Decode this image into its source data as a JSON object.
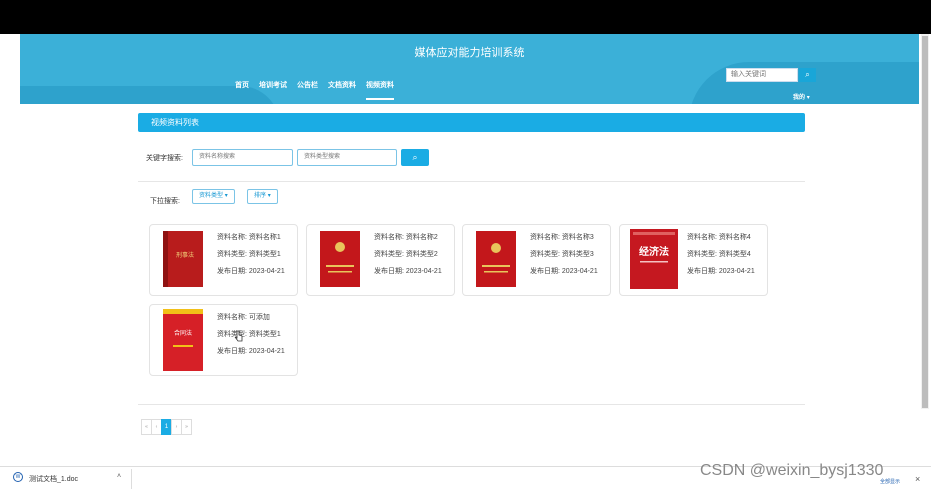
{
  "header": {
    "title": "媒体应对能力培训系统",
    "nav": [
      "首页",
      "培训考试",
      "公告栏",
      "文档资料",
      "视频资料"
    ],
    "active_nav": 4,
    "search_placeholder": "输入关键词",
    "user_menu": "我的"
  },
  "panel": {
    "title": "视频资料列表"
  },
  "search": {
    "label": "关键字搜索:",
    "name_placeholder": "资料名称搜索",
    "type_placeholder": "资料类型搜索"
  },
  "dropdown": {
    "label": "下拉搜索:",
    "type_button": "资料类型",
    "sort_button": "排序"
  },
  "fields": {
    "name": "资料名称:",
    "type": "资料类型:",
    "date": "发布日期:"
  },
  "items": [
    {
      "name": "资料名称1",
      "type": "资料类型1",
      "date": "2023-04-21",
      "cover_color": "#b81c1c",
      "cover_text": "刑事法"
    },
    {
      "name": "资料名称2",
      "type": "资料类型2",
      "date": "2023-04-21",
      "cover_color": "#c3171b",
      "cover_text": ""
    },
    {
      "name": "资料名称3",
      "type": "资料类型3",
      "date": "2023-04-21",
      "cover_color": "#c3171b",
      "cover_text": ""
    },
    {
      "name": "资料名称4",
      "type": "资料类型4",
      "date": "2023-04-21",
      "cover_color": "#c51820",
      "cover_text": "经济法"
    },
    {
      "name": "可添加",
      "type": "资料类型1",
      "date": "2023-04-21",
      "cover_color": "#d62027",
      "cover_text": "合同法"
    }
  ],
  "pagination": {
    "first": "«",
    "prev": "‹",
    "current": "1",
    "next": "›",
    "last": "»"
  },
  "browser": {
    "download_name": "测试文档_1.doc",
    "show_all": "全部显示",
    "close": "×",
    "chevron": "˄"
  },
  "watermark": "CSDN @weixin_bysj1330",
  "colors": {
    "header": "#3bb0d8",
    "accent": "#1aace4"
  }
}
